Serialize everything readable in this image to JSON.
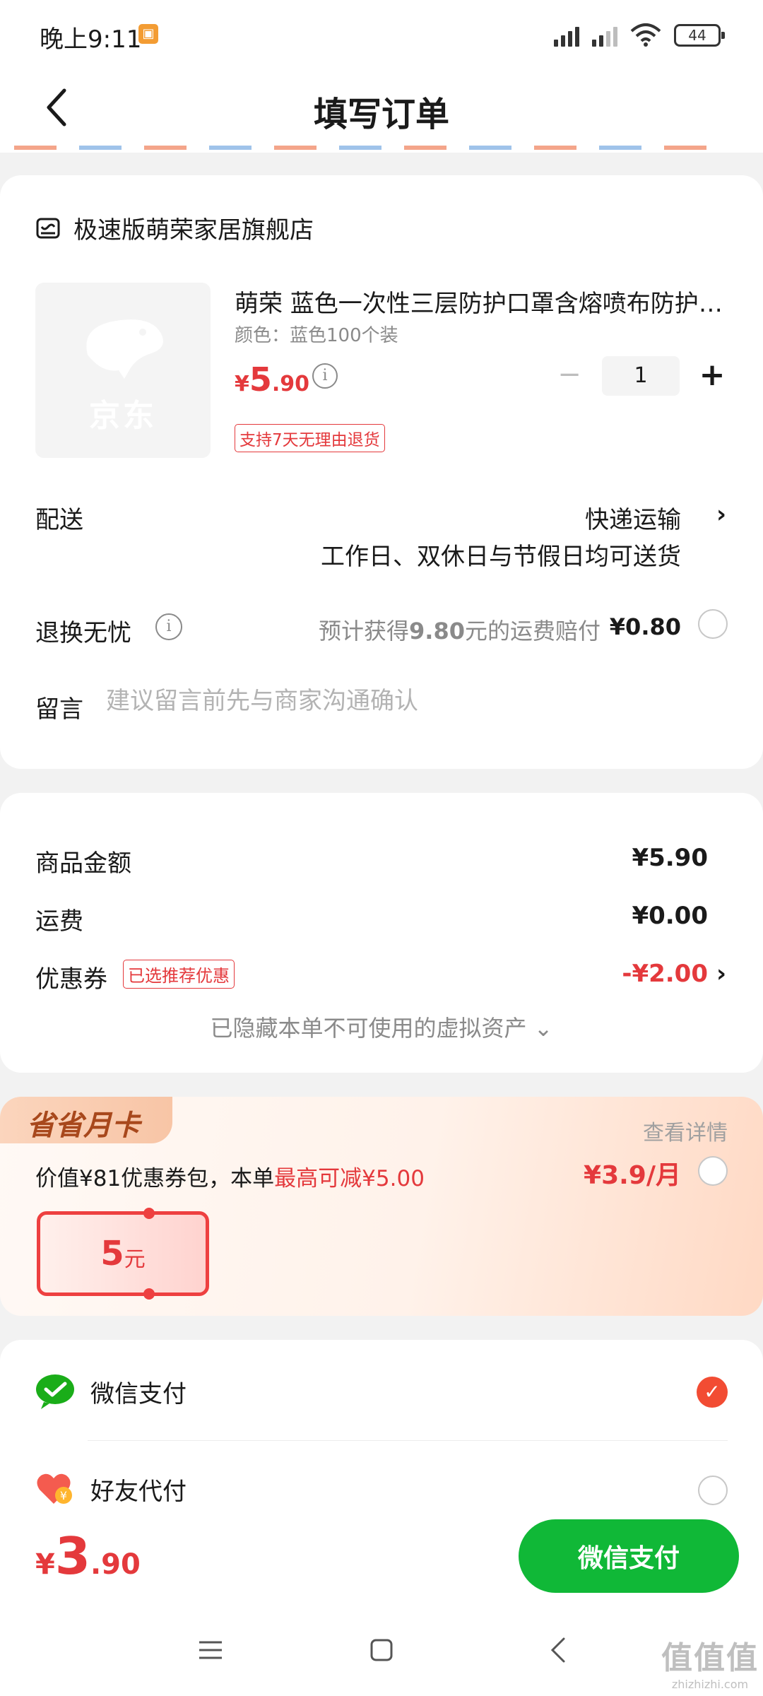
{
  "status_bar": {
    "time": "晚上9:11",
    "battery": "44"
  },
  "header": {
    "title": "填写订单"
  },
  "store": {
    "name": "极速版萌荣家居旗舰店"
  },
  "product": {
    "image_label": "京东",
    "name": "萌荣 蓝色一次性三层防护口罩含熔喷布防护口罩",
    "spec": "颜色：蓝色100个装",
    "price_symbol": "¥",
    "price_int": "5",
    "price_dec": ".90",
    "quantity": "1",
    "minus": "−",
    "plus": "+",
    "return_badge": "支持7天无理由退货"
  },
  "delivery": {
    "label": "配送",
    "method": "快递运输",
    "note": "工作日、双休日与节假日均可送货",
    "chevron": "›"
  },
  "refund": {
    "label": "退换无忧",
    "desc_prefix": "预计获得",
    "desc_amount": "9.80",
    "desc_suffix": "元的运费赔付",
    "price": "¥0.80"
  },
  "note": {
    "label": "留言",
    "placeholder": "建议留言前先与商家沟通确认"
  },
  "summary": {
    "goods_label": "商品金额",
    "goods_value": "¥5.90",
    "shipping_label": "运费",
    "shipping_value": "¥0.00",
    "coupon_label": "优惠券",
    "coupon_tag": "已选推荐优惠",
    "coupon_value": "-¥2.00",
    "chevron": "›",
    "hidden_assets": "已隐藏本单不可使用的虚拟资产 ⌄"
  },
  "monthly_card": {
    "banner": "省省月卡",
    "details": "查看详情",
    "desc_prefix": "价值¥81优惠券包，本单",
    "desc_highlight": "最高可减¥5.00",
    "price": "¥3.9/月",
    "voucher_amount": "5",
    "voucher_unit": "元"
  },
  "payment": {
    "wechat_label": "微信支付",
    "friend_label": "好友代付",
    "check": "✓"
  },
  "bottom": {
    "total_symbol": "¥",
    "total_int": "3",
    "total_dec": ".90",
    "pay_button": "微信支付"
  },
  "watermark": {
    "big": "值值值",
    "small": "zhizhizhi.com"
  },
  "colors": {
    "accent_red": "#e4393c",
    "wechat_green": "#10b837",
    "check_orange": "#f24c33"
  }
}
